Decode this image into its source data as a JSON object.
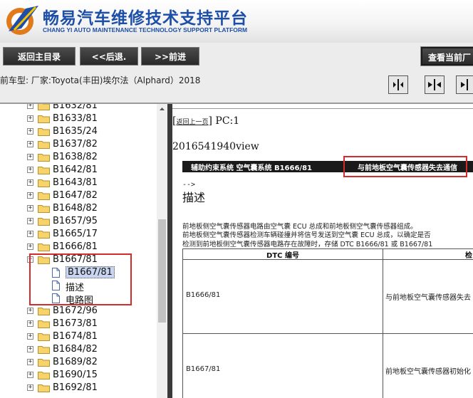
{
  "header": {
    "title": "畅易汽车维修技术支持平台",
    "subtitle": "CHANG YI AUTO MAINTENANCE TECHNOLOGY SUPPORT PLATFORM"
  },
  "nav": {
    "home": "返回主目录",
    "back": "<<后退.",
    "forward": ">>前进",
    "view": "查看当前厂"
  },
  "infobar": {
    "vehicle": "前车型:  厂家:Toyota(丰田)埃尔法（Alphard）2018"
  },
  "tree": {
    "items_top": [
      "B1632/81",
      "B1633/81",
      "B1635/24",
      "B1637/82",
      "B1638/82",
      "B1642/81",
      "B1643/81",
      "B1647/82",
      "B1648/82",
      "B1657/95",
      "B1665/17",
      "B1666/81"
    ],
    "expanded": {
      "label": "B1667/81",
      "children": [
        "B1667/81",
        "描述",
        "电路图"
      ]
    },
    "items_bottom": [
      "B1672/96",
      "B1673/81",
      "B1674/81",
      "B1684/82",
      "B1689/82",
      "B1690/15",
      "B1692/81"
    ]
  },
  "content": {
    "back_link": "返回上一页",
    "pc_label": "PC:1",
    "view_id": "2016541940view",
    "bar_left": "辅助约束系统  空气囊系统  B1666/81",
    "bar_right": "与前地板空气囊传感器失去通信",
    "arrow": "-->",
    "heading": "描述",
    "paragraphs": [
      "前地板侧空气囊传感器电路由空气囊 ECU 总成和前地板侧空气囊传感器组成。",
      "前地板侧空气囊传感器检测车辆碰撞并将信号发送到空气囊 ECU 总成，以确定是否",
      "检测到前地板侧空气囊传感器电路存在故障时，存储 DTC B1666/81 或 B1667/81"
    ],
    "table": {
      "headers": [
        "DTC 编号",
        "检"
      ],
      "rows": [
        [
          "B1666/81",
          "与前地板空气囊传感器失去"
        ],
        [
          "B1667/81",
          "前地板空气囊传感器初始化"
        ]
      ]
    }
  }
}
